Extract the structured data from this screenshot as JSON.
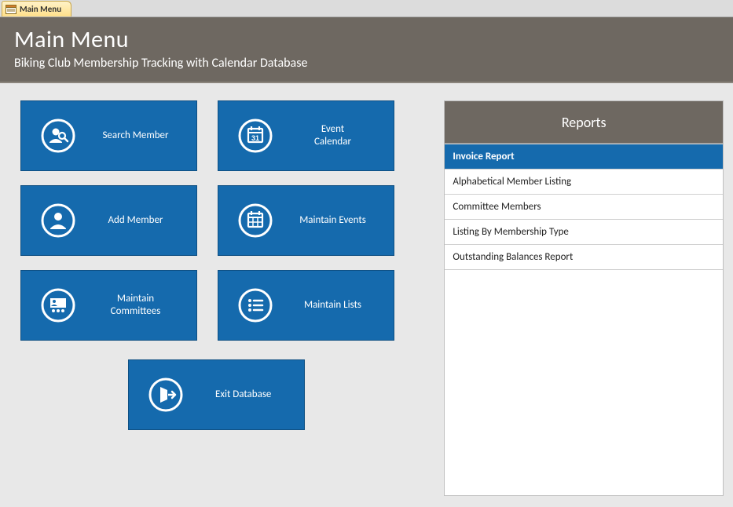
{
  "tab": {
    "label": "Main Menu"
  },
  "header": {
    "title": "Main Menu",
    "subtitle": "Biking Club Membership Tracking with Calendar Database"
  },
  "tiles": {
    "searchMember": "Search Member",
    "eventCalendar": "Event\nCalendar",
    "addMember": "Add Member",
    "maintainEvents": "Maintain Events",
    "maintainCommittees": "Maintain\nCommittees",
    "maintainLists": "Maintain Lists",
    "exitDatabase": "Exit Database"
  },
  "reportsPanel": {
    "title": "Reports",
    "items": [
      {
        "label": "Invoice Report",
        "selected": true
      },
      {
        "label": "Alphabetical  Member Listing",
        "selected": false
      },
      {
        "label": "Committee Members",
        "selected": false
      },
      {
        "label": "Listing By Membership Type",
        "selected": false
      },
      {
        "label": "Outstanding Balances Report",
        "selected": false
      }
    ]
  }
}
